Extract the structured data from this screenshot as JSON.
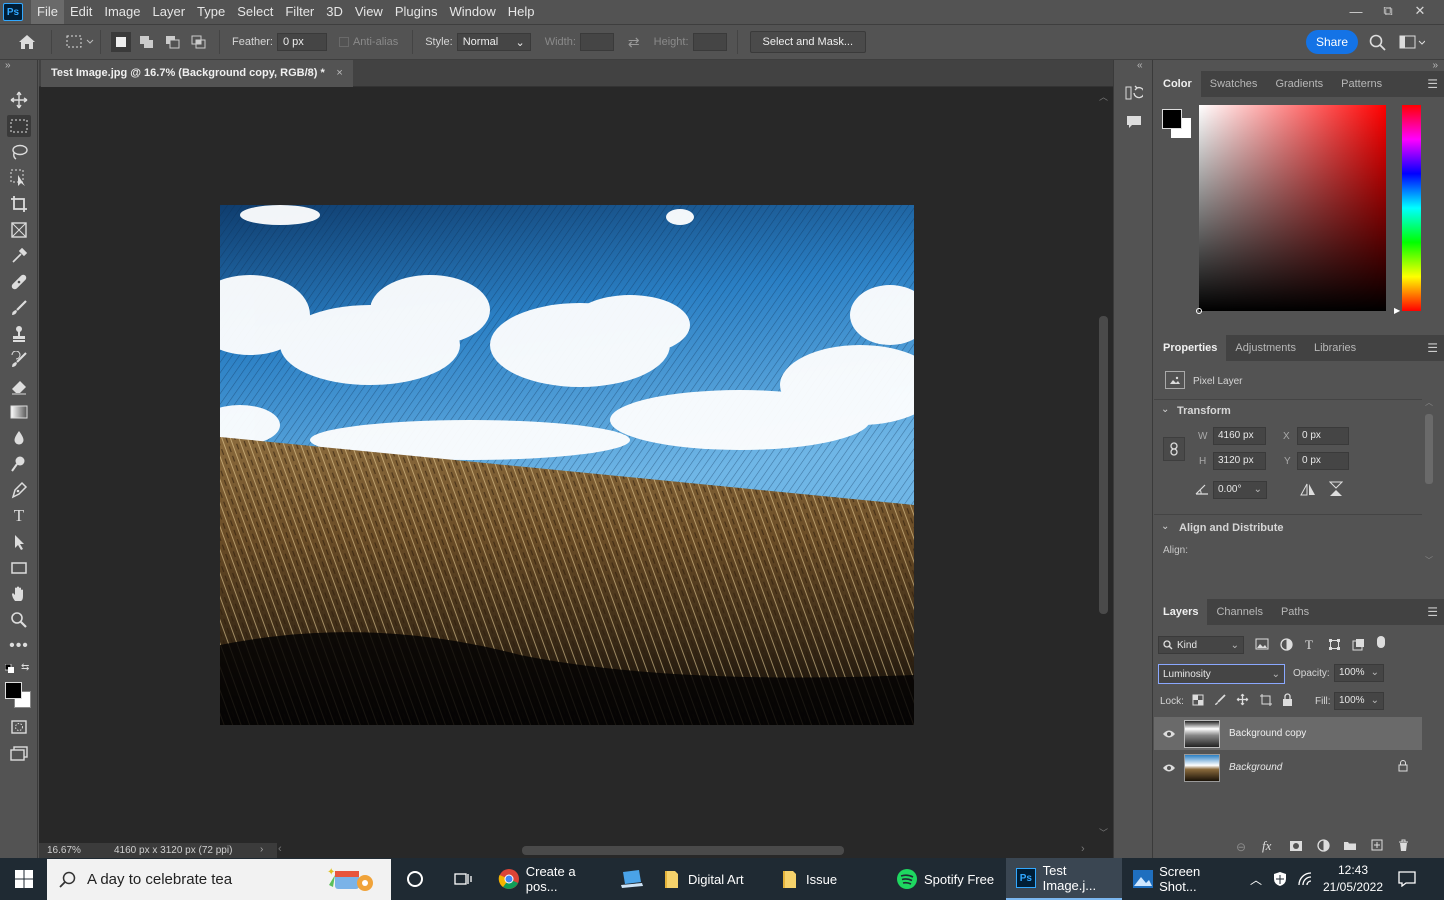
{
  "app": {
    "logo": "Ps"
  },
  "menu": [
    "File",
    "Edit",
    "Image",
    "Layer",
    "Type",
    "Select",
    "Filter",
    "3D",
    "View",
    "Plugins",
    "Window",
    "Help"
  ],
  "window_controls": {
    "minimize": "—",
    "restore": "⧉",
    "close": "✕"
  },
  "options": {
    "feather_label": "Feather:",
    "feather_value": "0 px",
    "antialias_label": "Anti-alias",
    "style_label": "Style:",
    "style_value": "Normal",
    "width_label": "Width:",
    "height_label": "Height:",
    "select_mask": "Select and Mask...",
    "share": "Share"
  },
  "document": {
    "tab_title": "Test Image.jpg @ 16.7% (Background copy, RGB/8) *",
    "zoom": "16.67%",
    "dimensions": "4160 px x 3120 px (72 ppi)"
  },
  "color_panel": {
    "tabs": [
      "Color",
      "Swatches",
      "Gradients",
      "Patterns"
    ],
    "foreground": "#000000",
    "background": "#ffffff"
  },
  "properties_panel": {
    "tabs": [
      "Properties",
      "Adjustments",
      "Libraries"
    ],
    "layer_type": "Pixel Layer",
    "transform_title": "Transform",
    "w_label": "W",
    "w_value": "4160 px",
    "h_label": "H",
    "h_value": "3120 px",
    "x_label": "X",
    "x_value": "0 px",
    "y_label": "Y",
    "y_value": "0 px",
    "angle_value": "0.00°",
    "align_title": "Align and Distribute",
    "align_label": "Align:"
  },
  "layers_panel": {
    "tabs": [
      "Layers",
      "Channels",
      "Paths"
    ],
    "kind_label": "Kind",
    "blend_mode": "Luminosity",
    "opacity_label": "Opacity:",
    "opacity_value": "100%",
    "lock_label": "Lock:",
    "fill_label": "Fill:",
    "fill_value": "100%",
    "layers": [
      {
        "name": "Background copy"
      },
      {
        "name": "Background"
      }
    ]
  },
  "taskbar": {
    "search_placeholder": "A day to celebrate tea",
    "apps": [
      "Create a pos...",
      "Digital Art",
      "Issue",
      "Spotify Free",
      "Test Image.j...",
      "Screen Shot..."
    ],
    "time": "12:43",
    "date": "21/05/2022"
  }
}
